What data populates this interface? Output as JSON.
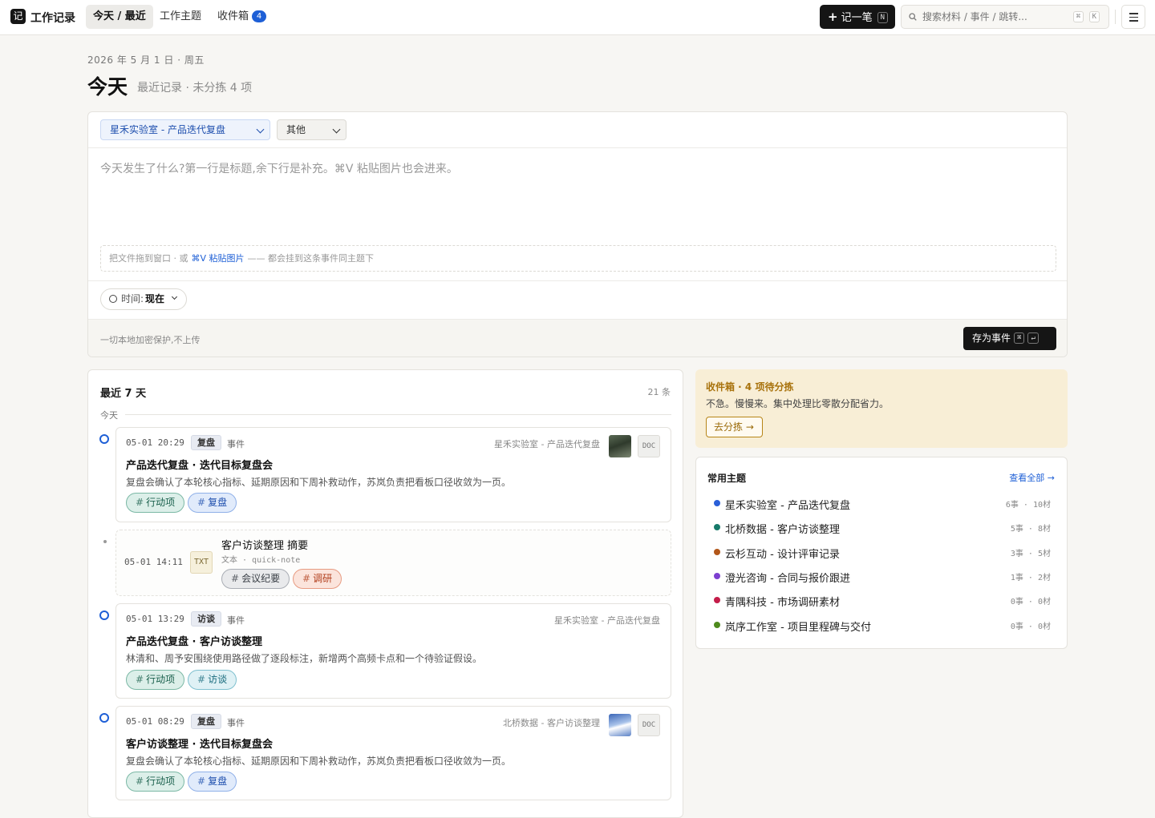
{
  "app": {
    "logo_glyph": "记",
    "title": "工作记录"
  },
  "nav": {
    "tabs": [
      {
        "label": "今天 / 最近",
        "active": true
      },
      {
        "label": "工作主题",
        "active": false
      },
      {
        "label": "收件箱",
        "active": false,
        "badge": "4"
      }
    ]
  },
  "toolbar": {
    "new_label": "记一笔",
    "new_shortcut": "N",
    "search_placeholder": "搜索材料 / 事件 / 跳转...",
    "search_shortcut_mod": "⌘",
    "search_shortcut_key": "K"
  },
  "header": {
    "date": "2026 年 5 月 1 日 · 周五",
    "title": "今天",
    "subtitle": "最近记录 · 未分拣 4 项"
  },
  "composer": {
    "topic_value": "星禾实验室 - 产品迭代复盘",
    "kind_value": "其他",
    "placeholder": "今天发生了什么?第一行是标题,余下行是补充。⌘V 粘贴图片也会进来。",
    "drop_prefix": "把文件拖到窗口 · 或",
    "drop_link": "⌘V 粘贴图片",
    "drop_suffix": "—— 都会挂到这条事件同主题下",
    "time_label": "时间:",
    "time_value": "现在",
    "privacy_note": "一切本地加密保护,不上传",
    "save_label": "存为事件",
    "save_mod": "⌘",
    "save_key": "↵"
  },
  "recent": {
    "title": "最近 7 天",
    "count": "21 条",
    "group_label": "今天",
    "events": [
      {
        "time": "05-01 20:29",
        "tag": "复盘",
        "kind": "事件",
        "topic": "星禾实验室 - 产品迭代复盘",
        "title": "产品迭代复盘 · 迭代目标复盘会",
        "desc": "复盘会确认了本轮核心指标、延期原因和下周补救动作，苏岚负责把看板口径收敛为一页。",
        "doc": "DOC",
        "tags": [
          "行动项",
          "复盘"
        ]
      },
      {
        "time": "05-01 13:29",
        "tag": "访谈",
        "kind": "事件",
        "topic": "星禾实验室 - 产品迭代复盘",
        "title": "产品迭代复盘 · 客户访谈整理",
        "desc": "林清和、周予安围绕使用路径做了逐段标注，新增两个高频卡点和一个待验证假设。",
        "tags": [
          "行动项",
          "访谈"
        ]
      },
      {
        "time": "05-01 08:29",
        "tag": "复盘",
        "kind": "事件",
        "topic": "北桥数据 - 客户访谈整理",
        "title": "客户访谈整理 · 迭代目标复盘会",
        "desc": "复盘会确认了本轮核心指标、延期原因和下周补救动作，苏岚负责把看板口径收敛为一页。",
        "doc": "DOC",
        "tags": [
          "行动项",
          "复盘"
        ]
      }
    ],
    "note": {
      "time": "05-01 14:11",
      "badge": "TXT",
      "title": "客户访谈整理 摘要",
      "meta": "文本 · quick-note",
      "tags": [
        "会议纪要",
        "调研"
      ]
    },
    "hash": "#"
  },
  "inbox": {
    "title": "收件箱 · 4 项待分拣",
    "desc": "不急。慢慢来。集中处理比零散分配省力。",
    "button": "去分拣 →"
  },
  "topics": {
    "title": "常用主题",
    "view_all": "查看全部 →",
    "items": [
      {
        "name": "星禾实验室 - 产品迭代复盘",
        "stats": "6事 · 10材",
        "color": "#2a5fd8"
      },
      {
        "name": "北桥数据 - 客户访谈整理",
        "stats": "5事 · 8材",
        "color": "#177a6a"
      },
      {
        "name": "云杉互动 - 设计评审记录",
        "stats": "3事 · 5材",
        "color": "#b2571a"
      },
      {
        "name": "澄光咨询 - 合同与报价跟进",
        "stats": "1事 · 2材",
        "color": "#7d3fd0"
      },
      {
        "name": "青隅科技 - 市场调研素材",
        "stats": "0事 · 0材",
        "color": "#c41d4a"
      },
      {
        "name": "岚序工作室 - 项目里程碑与交付",
        "stats": "0事 · 0材",
        "color": "#4e8a1c"
      }
    ]
  }
}
